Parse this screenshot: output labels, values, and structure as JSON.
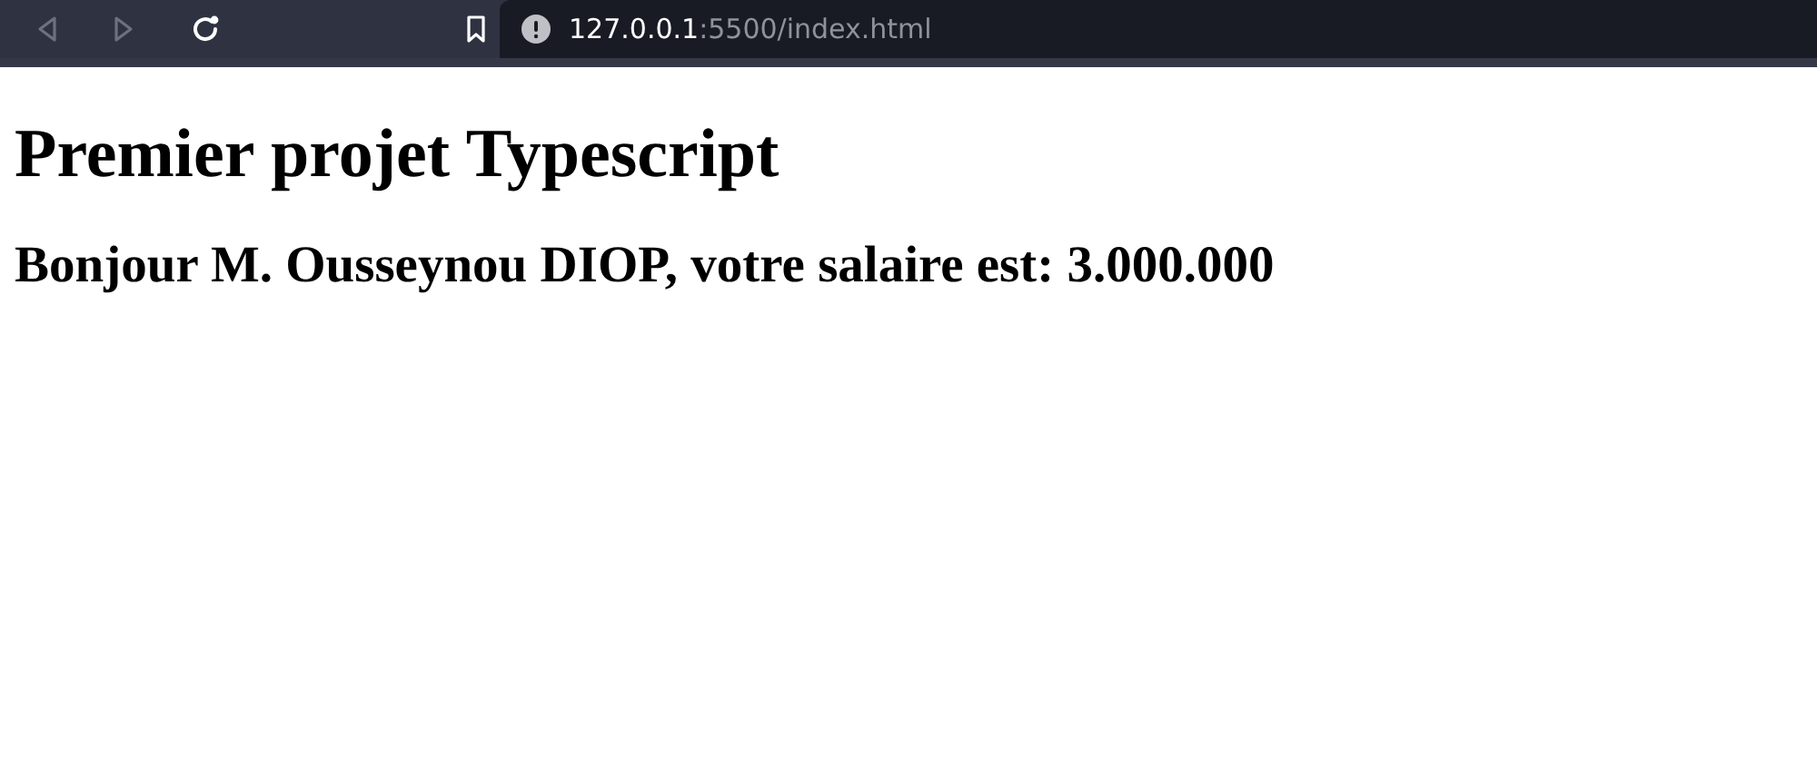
{
  "toolbar": {
    "back": {
      "disabled": true
    },
    "forward": {
      "disabled": true
    },
    "address": {
      "host": "127.0.0.1",
      "path": ":5500/index.html"
    }
  },
  "page": {
    "heading": "Premier projet Typescript",
    "greeting": "Bonjour M. Ousseynou DIOP, votre salaire est: 3.000.000"
  }
}
